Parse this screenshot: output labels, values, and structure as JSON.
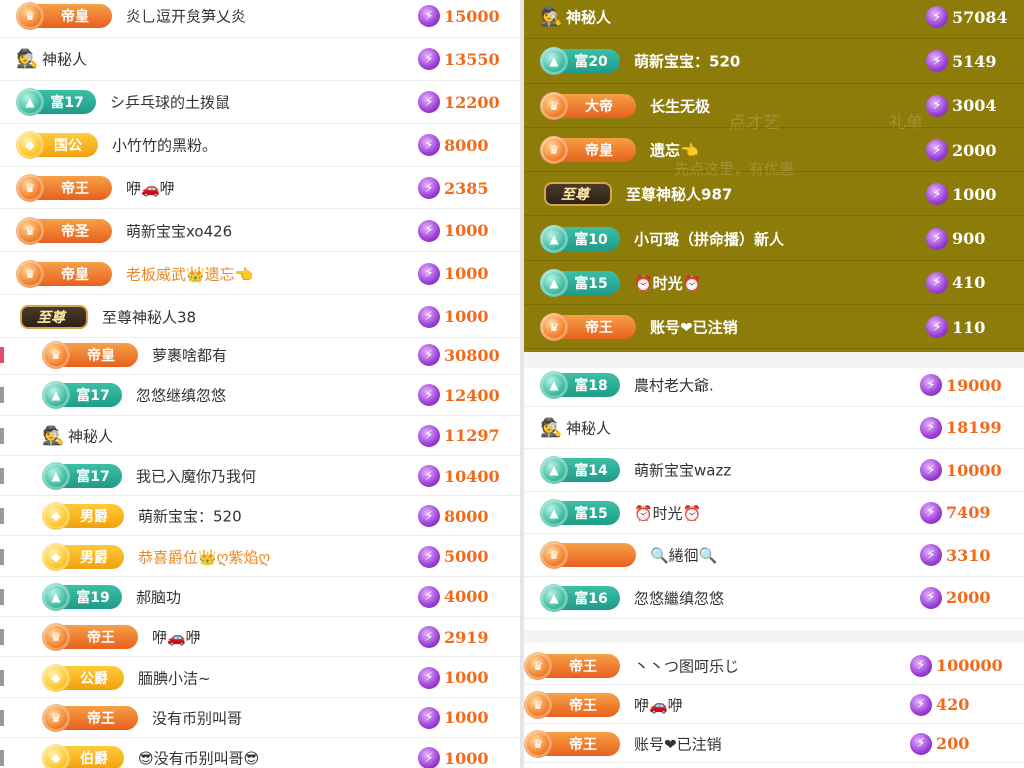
{
  "colors": {
    "score": "#f06a1a",
    "overlay": "#8d7b0a",
    "orange_badge": "#e8601e",
    "teal_badge": "#1f9c89",
    "gold_badge": "#f1a10e"
  },
  "left_top": [
    {
      "badge": "帝皇",
      "style": "orange",
      "gem": "♛",
      "name": "炎乚逗开炱笋乂炎",
      "score": "15000"
    },
    {
      "spy": true,
      "name": "神秘人",
      "score": "13550"
    },
    {
      "badge": "富17",
      "style": "teal",
      "gem": "▲",
      "name": "シ乒乓球的土拨鼠",
      "score": "12200"
    },
    {
      "badge": "国公",
      "style": "gold",
      "gem": "◆",
      "name": "小竹竹的黑粉。",
      "score": "8000"
    },
    {
      "badge": "帝王",
      "style": "orange",
      "gem": "♛",
      "name": "咿🚗咿",
      "score": "2385"
    },
    {
      "badge": "帝圣",
      "style": "orange",
      "gem": "♛",
      "name": "萌新宝宝xo426",
      "score": "1000"
    },
    {
      "badge": "帝皇",
      "style": "orange",
      "gem": "♛",
      "name": "老板威武👑遗忘👈",
      "vip": true,
      "score": "1000"
    },
    {
      "badge": "至尊",
      "style": "zun",
      "name": "至尊神秘人38",
      "score": "1000"
    }
  ],
  "left_bottom": [
    {
      "badge": "帝皇",
      "style": "orange",
      "gem": "♛",
      "name": "萝裹啥都有",
      "score": "30800",
      "mark": "red"
    },
    {
      "badge": "富17",
      "style": "teal",
      "gem": "▲",
      "name": "忽悠继缜忽悠",
      "score": "12400",
      "mark": "gray"
    },
    {
      "spy": true,
      "name": "神秘人",
      "score": "11297",
      "mark": "gray"
    },
    {
      "badge": "富17",
      "style": "teal",
      "gem": "▲",
      "name": "我已入魔你乃我何",
      "score": "10400",
      "mark": "gray"
    },
    {
      "badge": "男爵",
      "style": "gold",
      "gem": "◆",
      "name": "萌新宝宝：520",
      "score": "8000",
      "mark": "gray"
    },
    {
      "badge": "男爵",
      "style": "gold",
      "gem": "◆",
      "name": "恭喜爵位👑ღ紫焰ღ",
      "vip": true,
      "score": "5000",
      "mark": "gray"
    },
    {
      "badge": "富19",
      "style": "teal",
      "gem": "▲",
      "name": "郝脑功",
      "score": "4000",
      "mark": "gray"
    },
    {
      "badge": "帝王",
      "style": "orange",
      "gem": "♛",
      "name": "咿🚗咿",
      "score": "2919",
      "mark": "gray"
    },
    {
      "badge": "公爵",
      "style": "gold",
      "gem": "◆",
      "name": "腼腆小洁~",
      "score": "1000",
      "mark": "gray"
    },
    {
      "badge": "帝王",
      "style": "orange",
      "gem": "♛",
      "name": "没有币别叫哥",
      "score": "1000",
      "mark": "gray"
    },
    {
      "badge": "伯爵",
      "style": "gold",
      "gem": "◆",
      "name": "😎没有币别叫哥😎",
      "score": "1000",
      "mark": "gray"
    }
  ],
  "right_top": [
    {
      "spy": true,
      "name": "神秘人",
      "score": "57084"
    },
    {
      "badge": "富20",
      "style": "teal",
      "gem": "▲",
      "name": "萌新宝宝：520",
      "score": "5149"
    },
    {
      "badge": "大帝",
      "style": "orange",
      "gem": "♛",
      "name": "长生无极",
      "score": "3004"
    },
    {
      "badge": "帝皇",
      "style": "orange",
      "gem": "♛",
      "name": "遗忘👈",
      "score": "2000"
    },
    {
      "badge": "至尊",
      "style": "zun",
      "name": "至尊神秘人987",
      "score": "1000"
    },
    {
      "badge": "富10",
      "style": "teal",
      "gem": "▲",
      "name": "小可璐（拼命播）新人",
      "score": "900"
    },
    {
      "badge": "富15",
      "style": "teal",
      "gem": "▲",
      "name": "⏰时光⏰",
      "score": "410"
    },
    {
      "badge": "帝王",
      "style": "orange",
      "gem": "♛",
      "name": "账号❤已注销",
      "score": "110"
    }
  ],
  "right_top_ghost": {
    "t1": "点才艺",
    "t2": "礼单",
    "t3": "先点这里，有优惠"
  },
  "right_mid": [
    {
      "badge": "富18",
      "style": "teal",
      "gem": "▲",
      "name": "農村老大爺.",
      "score": "19000"
    },
    {
      "spy": true,
      "name": "神秘人",
      "score": "18199"
    },
    {
      "badge": "富14",
      "style": "teal",
      "gem": "▲",
      "name": "萌新宝宝wazz",
      "score": "10000"
    },
    {
      "badge": "富15",
      "style": "teal",
      "gem": "▲",
      "name": "⏰时光⏰",
      "score": "7409"
    },
    {
      "badge": "",
      "style": "orange",
      "gem": "♛",
      "name": "🔍綣徊🔍",
      "score": "3310"
    },
    {
      "badge": "富16",
      "style": "teal",
      "gem": "▲",
      "name": "忽悠繼缜忽悠",
      "score": "2000"
    }
  ],
  "right_bottom": [
    {
      "badge": "帝王",
      "style": "orange",
      "gem": "♛",
      "name": "丶丶つ图呵乐じ",
      "score": "100000"
    },
    {
      "badge": "帝王",
      "style": "orange",
      "gem": "♛",
      "name": "咿🚗咿",
      "score": "420"
    },
    {
      "badge": "帝王",
      "style": "orange",
      "gem": "♛",
      "name": "账号❤已注销",
      "score": "200"
    }
  ]
}
